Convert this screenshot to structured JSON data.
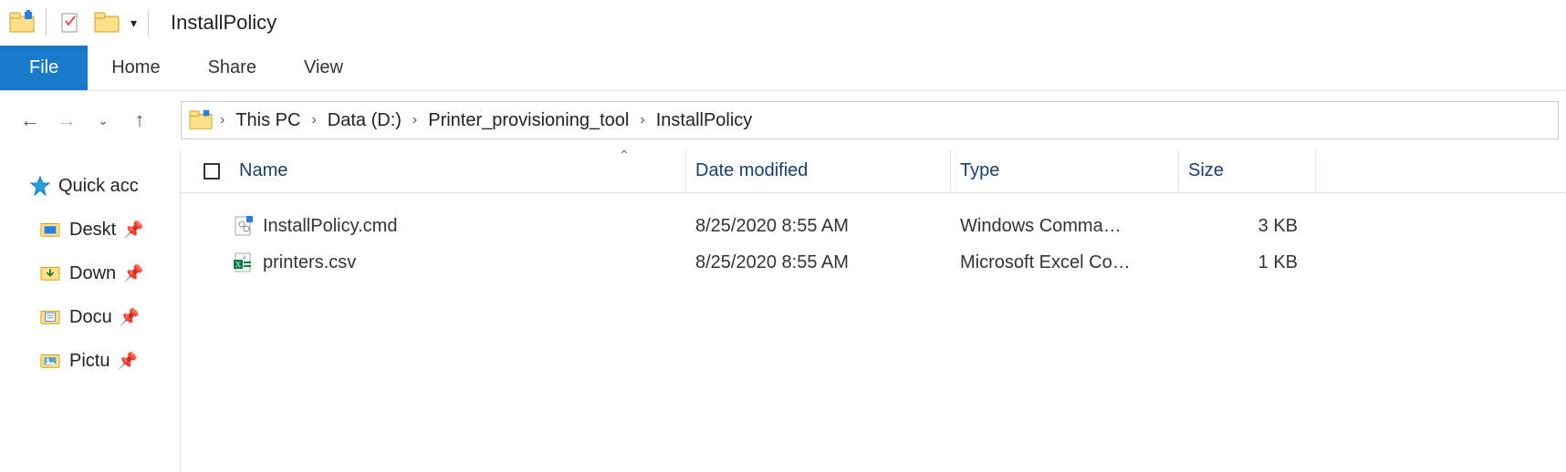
{
  "title": "InstallPolicy",
  "ribbon": {
    "file": "File",
    "home": "Home",
    "share": "Share",
    "view": "View"
  },
  "breadcrumb": [
    "This PC",
    "Data (D:)",
    "Printer_provisioning_tool",
    "InstallPolicy"
  ],
  "columns": {
    "name": "Name",
    "date": "Date modified",
    "type": "Type",
    "size": "Size"
  },
  "sidebar": {
    "root": "Quick acc",
    "items": [
      {
        "label": "Deskt",
        "icon": "desktop",
        "pinned": true
      },
      {
        "label": "Down",
        "icon": "downloads",
        "pinned": true
      },
      {
        "label": "Docu",
        "icon": "documents",
        "pinned": true
      },
      {
        "label": "Pictu",
        "icon": "pictures",
        "pinned": true
      }
    ]
  },
  "files": [
    {
      "name": "InstallPolicy.cmd",
      "date": "8/25/2020 8:55 AM",
      "type": "Windows Comma…",
      "size": "3 KB",
      "icon": "cmd"
    },
    {
      "name": "printers.csv",
      "date": "8/25/2020 8:55 AM",
      "type": "Microsoft Excel Co…",
      "size": "1 KB",
      "icon": "csv"
    }
  ]
}
